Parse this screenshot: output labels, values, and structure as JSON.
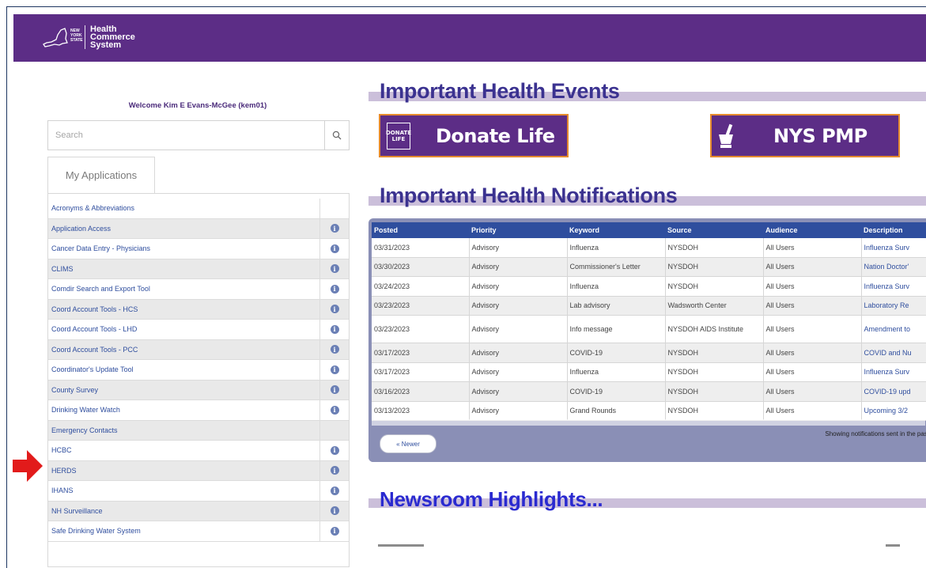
{
  "header": {
    "logo_state_text": "NEW YORK STATE",
    "logo_lines": [
      "Health",
      "Commerce",
      "System"
    ],
    "brand_color": "#5c2d86"
  },
  "sidebar": {
    "welcome": "Welcome Kim E Evans-McGee (kem01)",
    "search_placeholder": "Search",
    "tab_label": "My Applications",
    "apps": [
      {
        "name": "Acronyms & Abbreviations",
        "info": false
      },
      {
        "name": "Application Access",
        "info": true
      },
      {
        "name": "Cancer Data Entry - Physicians",
        "info": true
      },
      {
        "name": "CLIMS",
        "info": true
      },
      {
        "name": "Comdir Search and Export Tool",
        "info": true
      },
      {
        "name": "Coord Account Tools - HCS",
        "info": true
      },
      {
        "name": "Coord Account Tools - LHD",
        "info": true
      },
      {
        "name": "Coord Account Tools - PCC",
        "info": true
      },
      {
        "name": "Coordinator's Update Tool",
        "info": true
      },
      {
        "name": "County Survey",
        "info": true
      },
      {
        "name": "Drinking Water Watch",
        "info": true
      },
      {
        "name": "Emergency Contacts",
        "info": false
      },
      {
        "name": "HCBC",
        "info": true
      },
      {
        "name": "HERDS",
        "info": true
      },
      {
        "name": "IHANS",
        "info": true
      },
      {
        "name": "NH Surveillance",
        "info": true
      },
      {
        "name": "Safe Drinking Water System",
        "info": true
      }
    ]
  },
  "events": {
    "title": "Important Health Events",
    "donate_icon_text": "DONATE LIFE",
    "donate_label": "Donate Life",
    "pmp_label": "NYS PMP"
  },
  "notifications": {
    "title": "Important Health Notifications",
    "columns": [
      "Posted",
      "Priority",
      "Keyword",
      "Source",
      "Audience",
      "Description"
    ],
    "rows": [
      [
        "03/31/2023",
        "Advisory",
        "Influenza",
        "NYSDOH",
        "All Users",
        "Influenza Surv"
      ],
      [
        "03/30/2023",
        "Advisory",
        "Commissioner's Letter",
        "NYSDOH",
        "All Users",
        "Nation Doctor'"
      ],
      [
        "03/24/2023",
        "Advisory",
        "Influenza",
        "NYSDOH",
        "All Users",
        "Influenza Surv"
      ],
      [
        "03/23/2023",
        "Advisory",
        "Lab advisory",
        "Wadsworth Center",
        "All Users",
        "Laboratory Re"
      ],
      [
        "03/23/2023",
        "Advisory",
        "Info message",
        "NYSDOH AIDS Institute",
        "All Users",
        "Amendment to"
      ],
      [
        "03/17/2023",
        "Advisory",
        "COVID-19",
        "NYSDOH",
        "All Users",
        "COVID and Nu"
      ],
      [
        "03/17/2023",
        "Advisory",
        "Influenza",
        "NYSDOH",
        "All Users",
        "Influenza Surv"
      ],
      [
        "03/16/2023",
        "Advisory",
        "COVID-19",
        "NYSDOH",
        "All Users",
        "COVID-19 upd"
      ],
      [
        "03/13/2023",
        "Advisory",
        "Grand Rounds",
        "NYSDOH",
        "All Users",
        "Upcoming 3/2"
      ]
    ],
    "newer_button": "« Newer",
    "showing_text": "Showing notifications sent in the past"
  },
  "newsroom": {
    "title": "Newsroom Highlights..."
  }
}
